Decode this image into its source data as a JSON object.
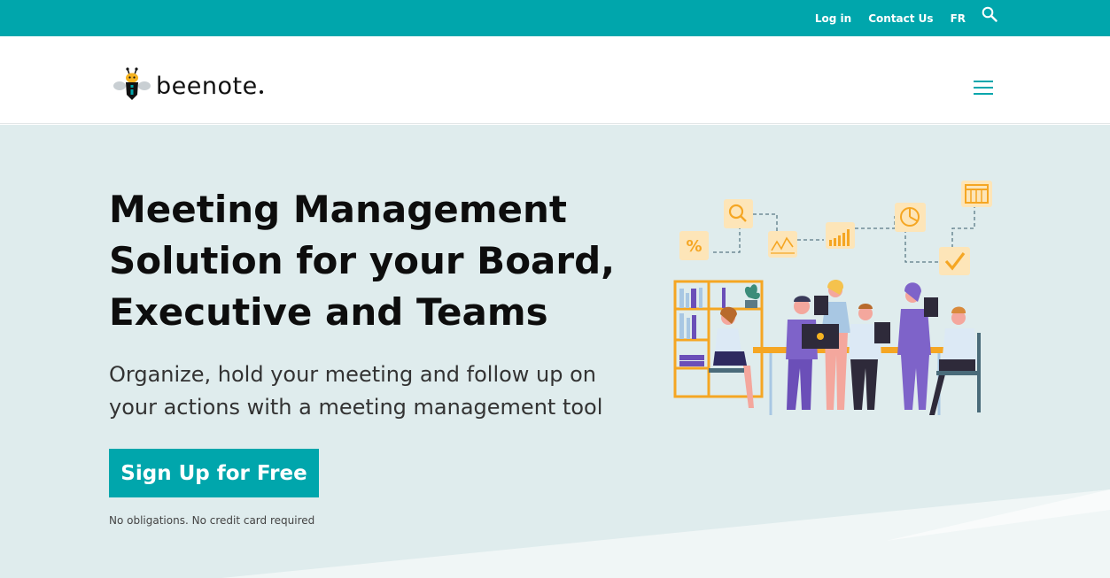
{
  "topbar": {
    "links": [
      "Log in",
      "Contact Us",
      "FR"
    ],
    "search_icon": "search-icon"
  },
  "header": {
    "logo_text": "beenote",
    "menu_icon": "hamburger-menu-icon"
  },
  "hero": {
    "headline_lines": [
      "Meeting Management",
      "Solution for your Board,",
      "Executive and Teams"
    ],
    "subtitle_lines": [
      "Organize, hold your meeting and follow up on",
      "your actions with a meeting management tool"
    ],
    "cta_label": "Sign Up for Free",
    "note": "No obligations. No credit card required"
  },
  "colors": {
    "accent": "#00a6ac",
    "hero_bg": "#dfeced",
    "icon_tile": "#fde5b8",
    "icon_stroke": "#f5a623"
  }
}
